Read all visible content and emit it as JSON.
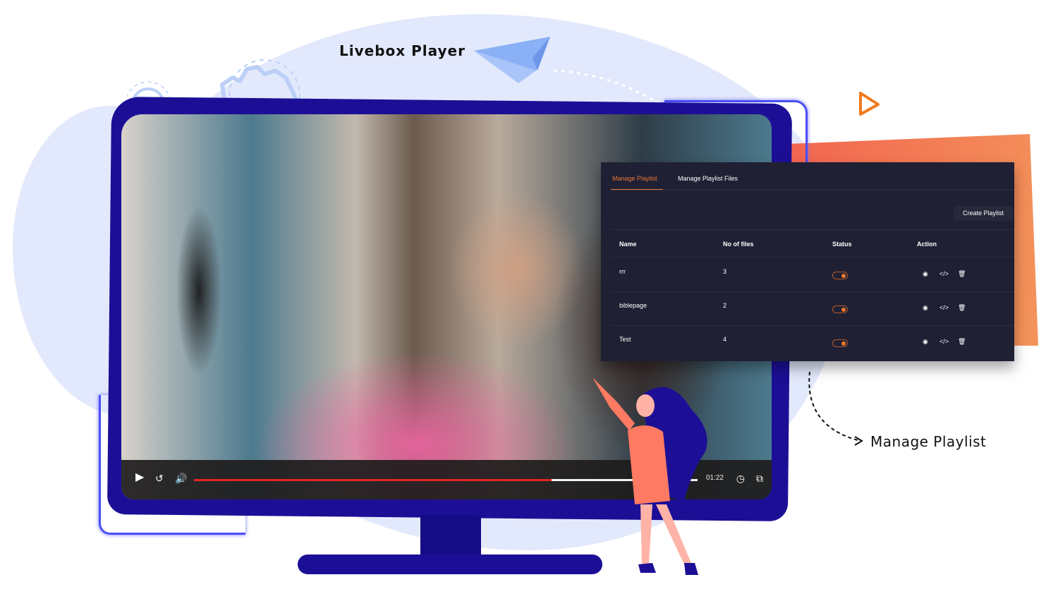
{
  "labels": {
    "player_title": "Livebox Player",
    "playlist_annotation": "Manage Playlist"
  },
  "colors": {
    "monitor": "#1c0f96",
    "accent_orange": "#e8773a",
    "panel_bg": "#1f2033",
    "progress_red": "#e52424",
    "blob": "#e3e9fc"
  },
  "video_player": {
    "progress_percent": 71,
    "time": "01:22",
    "icons": {
      "play": "play-icon",
      "rewind": "replay-10-icon",
      "volume": "volume-icon",
      "speed": "speedometer-icon",
      "pip": "picture-in-picture-icon"
    }
  },
  "playlist_panel": {
    "tabs": [
      {
        "label": "Manage Playlist",
        "active": true
      },
      {
        "label": "Manage Playlist Files",
        "active": false
      }
    ],
    "create_button": "Create Playlist",
    "columns": [
      "Name",
      "No of files",
      "Status",
      "Action"
    ],
    "rows": [
      {
        "name": "rrr",
        "files": "3",
        "status": "on"
      },
      {
        "name": "biblepage",
        "files": "2",
        "status": "on"
      },
      {
        "name": "Test",
        "files": "4",
        "status": "on"
      }
    ],
    "action_icons": [
      "play-circle-icon",
      "code-embed-icon",
      "trash-icon"
    ]
  }
}
